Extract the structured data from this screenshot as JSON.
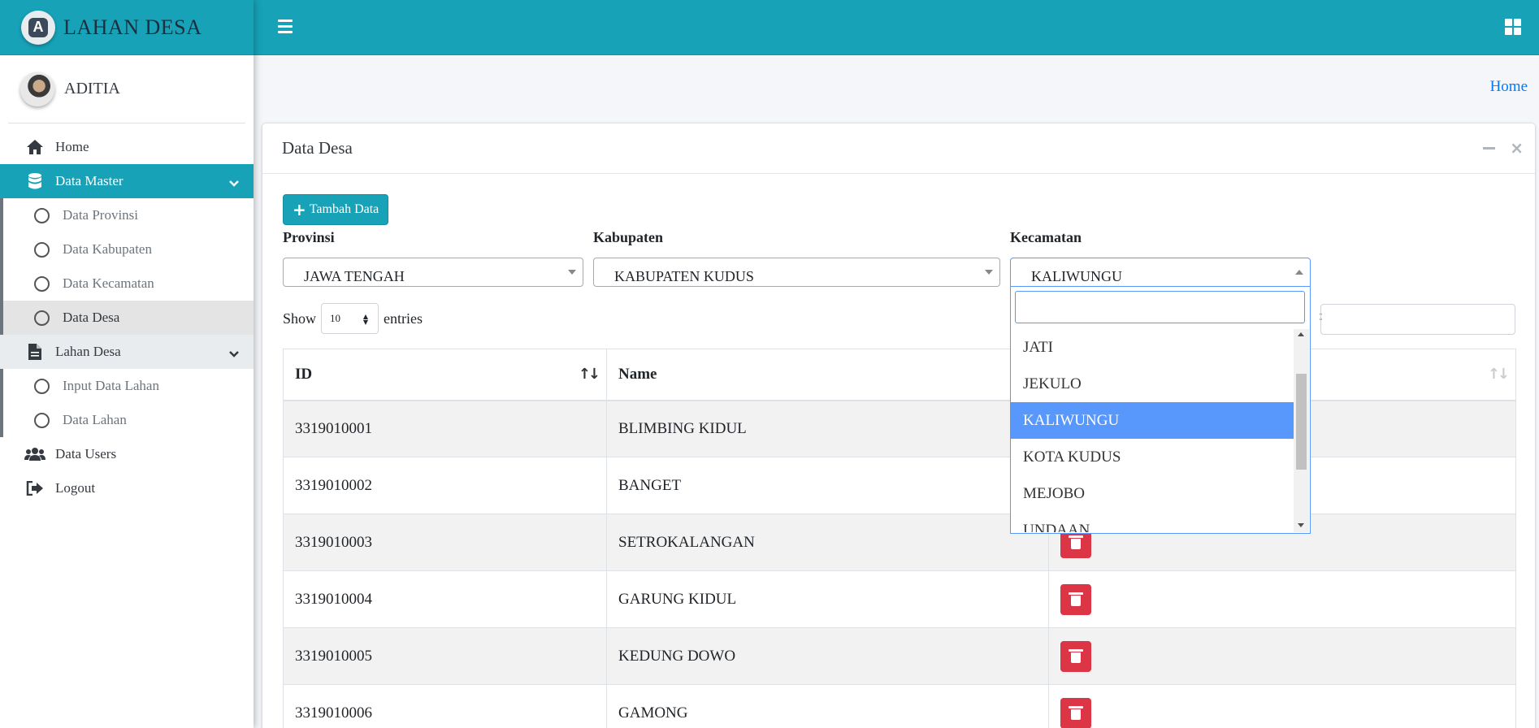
{
  "brand": {
    "title": "LAHAN DESA",
    "logo_letter": "A"
  },
  "user": {
    "name": "ADITIA"
  },
  "sidebar": {
    "items": [
      {
        "label": "Home",
        "icon": "home-icon"
      },
      {
        "label": "Data Master",
        "icon": "database-icon",
        "active": true,
        "children": [
          "Data Provinsi",
          "Data Kabupaten",
          "Data Kecamatan",
          "Data Desa"
        ]
      },
      {
        "label": "Lahan Desa",
        "icon": "file-icon",
        "children": [
          "Input Data Lahan",
          "Data Lahan"
        ]
      },
      {
        "label": "Data Users",
        "icon": "users-icon"
      },
      {
        "label": "Logout",
        "icon": "sign-out-icon"
      }
    ],
    "current_sub": "Data Desa"
  },
  "breadcrumb": {
    "home": "Home"
  },
  "card": {
    "title": "Data Desa"
  },
  "toolbar": {
    "add_label": "Tambah Data"
  },
  "filters": {
    "provinsi": {
      "label": "Provinsi",
      "value": "JAWA TENGAH"
    },
    "kabupaten": {
      "label": "Kabupaten",
      "value": "KABUPATEN KUDUS"
    },
    "kecamatan": {
      "label": "Kecamatan",
      "value": "KALIWUNGU"
    }
  },
  "dropdown": {
    "search_value": "",
    "options": [
      "JATI",
      "JEKULO",
      "KALIWUNGU",
      "KOTA KUDUS",
      "MEJOBO",
      "UNDAAN"
    ],
    "selected": "KALIWUNGU"
  },
  "table_controls": {
    "show_label": "Show",
    "entries_label": "entries",
    "page_length": "10",
    "search_label": ":"
  },
  "table": {
    "columns": [
      "ID",
      "Name"
    ],
    "rows": [
      {
        "id": "3319010001",
        "name": "BLIMBING KIDUL"
      },
      {
        "id": "3319010002",
        "name": "BANGET"
      },
      {
        "id": "3319010003",
        "name": "SETROKALANGAN"
      },
      {
        "id": "3319010004",
        "name": "GARUNG KIDUL"
      },
      {
        "id": "3319010005",
        "name": "KEDUNG DOWO"
      },
      {
        "id": "3319010006",
        "name": "GAMONG"
      }
    ]
  },
  "colors": {
    "primary": "#17a2b8",
    "danger": "#dc3545",
    "link": "#007bff",
    "select_highlight": "#5897fb"
  }
}
